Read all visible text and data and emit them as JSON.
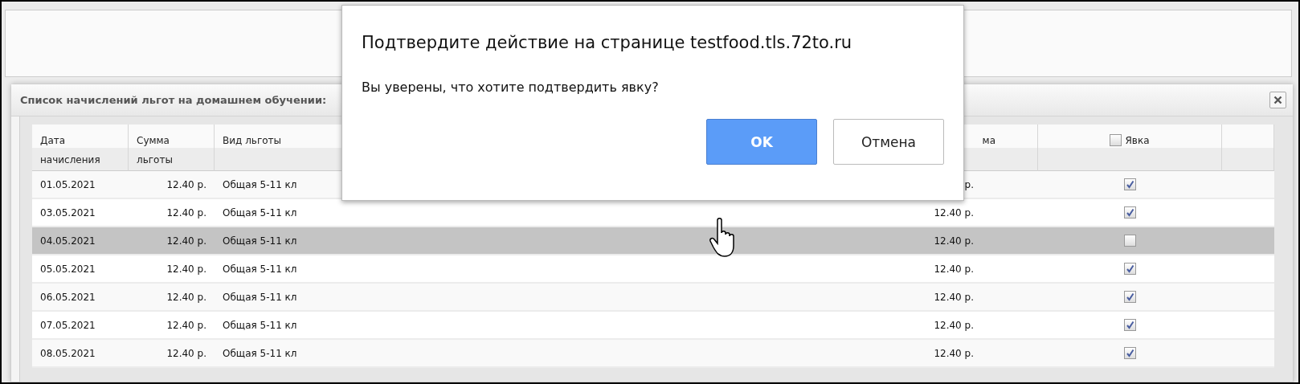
{
  "panel": {
    "title": "Список начислений льгот на домашнем обучении:"
  },
  "table": {
    "columns": [
      {
        "label": "Дата начисления",
        "kind": "text"
      },
      {
        "label": "Сумма льготы",
        "kind": "text"
      },
      {
        "label": "Вид льготы",
        "kind": "text"
      },
      {
        "label": "ма",
        "kind": "text"
      },
      {
        "label": "Явка",
        "kind": "check",
        "checked": false
      },
      {
        "kind": "empty"
      }
    ],
    "rows": [
      {
        "date": "01.05.2021",
        "amount": "12.40 р.",
        "type": "Общая 5-11 кл",
        "amount_2": "р.",
        "attended": true,
        "selected": false
      },
      {
        "date": "03.05.2021",
        "amount": "12.40 р.",
        "type": "Общая 5-11 кл",
        "amount_2": "12.40 р.",
        "attended": true,
        "selected": false
      },
      {
        "date": "04.05.2021",
        "amount": "12.40 р.",
        "type": "Общая 5-11 кл",
        "amount_2": "12.40 р.",
        "attended": false,
        "selected": true
      },
      {
        "date": "05.05.2021",
        "amount": "12.40 р.",
        "type": "Общая 5-11 кл",
        "amount_2": "12.40 р.",
        "attended": true,
        "selected": false
      },
      {
        "date": "06.05.2021",
        "amount": "12.40 р.",
        "type": "Общая 5-11 кл",
        "amount_2": "12.40 р.",
        "attended": true,
        "selected": false
      },
      {
        "date": "07.05.2021",
        "amount": "12.40 р.",
        "type": "Общая 5-11 кл",
        "amount_2": "12.40 р.",
        "attended": true,
        "selected": false
      },
      {
        "date": "08.05.2021",
        "amount": "12.40 р.",
        "type": "Общая 5-11 кл",
        "amount_2": "12.40 р.",
        "attended": true,
        "selected": false
      }
    ]
  },
  "confirm": {
    "title": "Подтвердите действие на странице testfood.tls.72to.ru",
    "message": "Вы уверены, что хотите подтвердить явку?",
    "buttons": [
      {
        "label": "OK",
        "kind": "primary"
      },
      {
        "label": "Отмена",
        "kind": "secondary"
      }
    ]
  }
}
